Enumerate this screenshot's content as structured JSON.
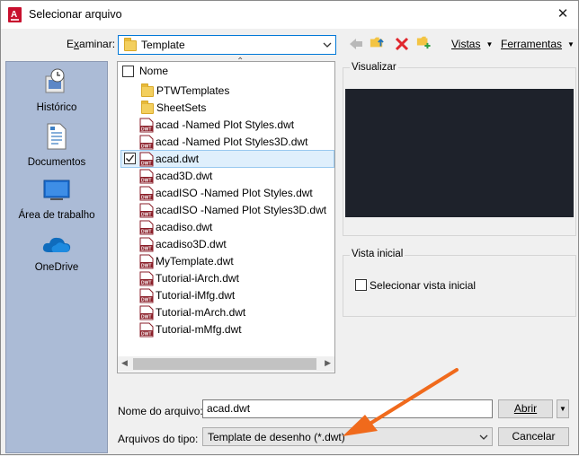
{
  "window": {
    "title": "Selecionar arquivo",
    "close_glyph": "✕"
  },
  "examinar": {
    "label_pre": "E",
    "label_u": "x",
    "label_post": "aminar:",
    "value": "Template"
  },
  "toolbar": {
    "views_label": "Vistas",
    "tools_label": "Ferramentas",
    "icons": [
      "back-arrow-icon",
      "folder-up-icon",
      "delete-icon",
      "new-folder-icon"
    ]
  },
  "places": [
    {
      "label": "Histórico",
      "icon": "history-icon"
    },
    {
      "label": "Documentos",
      "icon": "documents-icon"
    },
    {
      "label": "Área de trabalho",
      "icon": "desktop-icon"
    },
    {
      "label": "OneDrive",
      "icon": "onedrive-icon"
    }
  ],
  "filelist": {
    "column_name": "Nome",
    "items": [
      {
        "name": "PTWTemplates",
        "type": "folder"
      },
      {
        "name": "SheetSets",
        "type": "folder"
      },
      {
        "name": "acad -Named Plot Styles.dwt",
        "type": "dwt"
      },
      {
        "name": "acad -Named Plot Styles3D.dwt",
        "type": "dwt"
      },
      {
        "name": "acad.dwt",
        "type": "dwt",
        "selected": true
      },
      {
        "name": "acad3D.dwt",
        "type": "dwt"
      },
      {
        "name": "acadISO -Named Plot Styles.dwt",
        "type": "dwt"
      },
      {
        "name": "acadISO -Named Plot Styles3D.dwt",
        "type": "dwt"
      },
      {
        "name": "acadiso.dwt",
        "type": "dwt"
      },
      {
        "name": "acadiso3D.dwt",
        "type": "dwt"
      },
      {
        "name": "MyTemplate.dwt",
        "type": "dwt"
      },
      {
        "name": "Tutorial-iArch.dwt",
        "type": "dwt"
      },
      {
        "name": "Tutorial-iMfg.dwt",
        "type": "dwt"
      },
      {
        "name": "Tutorial-mArch.dwt",
        "type": "dwt"
      },
      {
        "name": "Tutorial-mMfg.dwt",
        "type": "dwt"
      }
    ]
  },
  "preview": {
    "title": "Visualizar"
  },
  "initial_view": {
    "title": "Vista inicial",
    "checkbox_label": "Selecionar vista inicial",
    "checked": false
  },
  "bottom": {
    "filename_label": "Nome do arquivo:",
    "filename_value": "acad.dwt",
    "filetype_label": "Arquivos do tipo:",
    "filetype_value": "Template de desenho (*.dwt)",
    "open_label": "Abrir",
    "cancel_label": "Cancelar"
  },
  "colors": {
    "accent": "#0078d7",
    "annotation_arrow": "#f06a1c",
    "places_bg": "#abbbd6",
    "preview_bg": "#1e222b",
    "autodesk_red": "#c8102e"
  }
}
